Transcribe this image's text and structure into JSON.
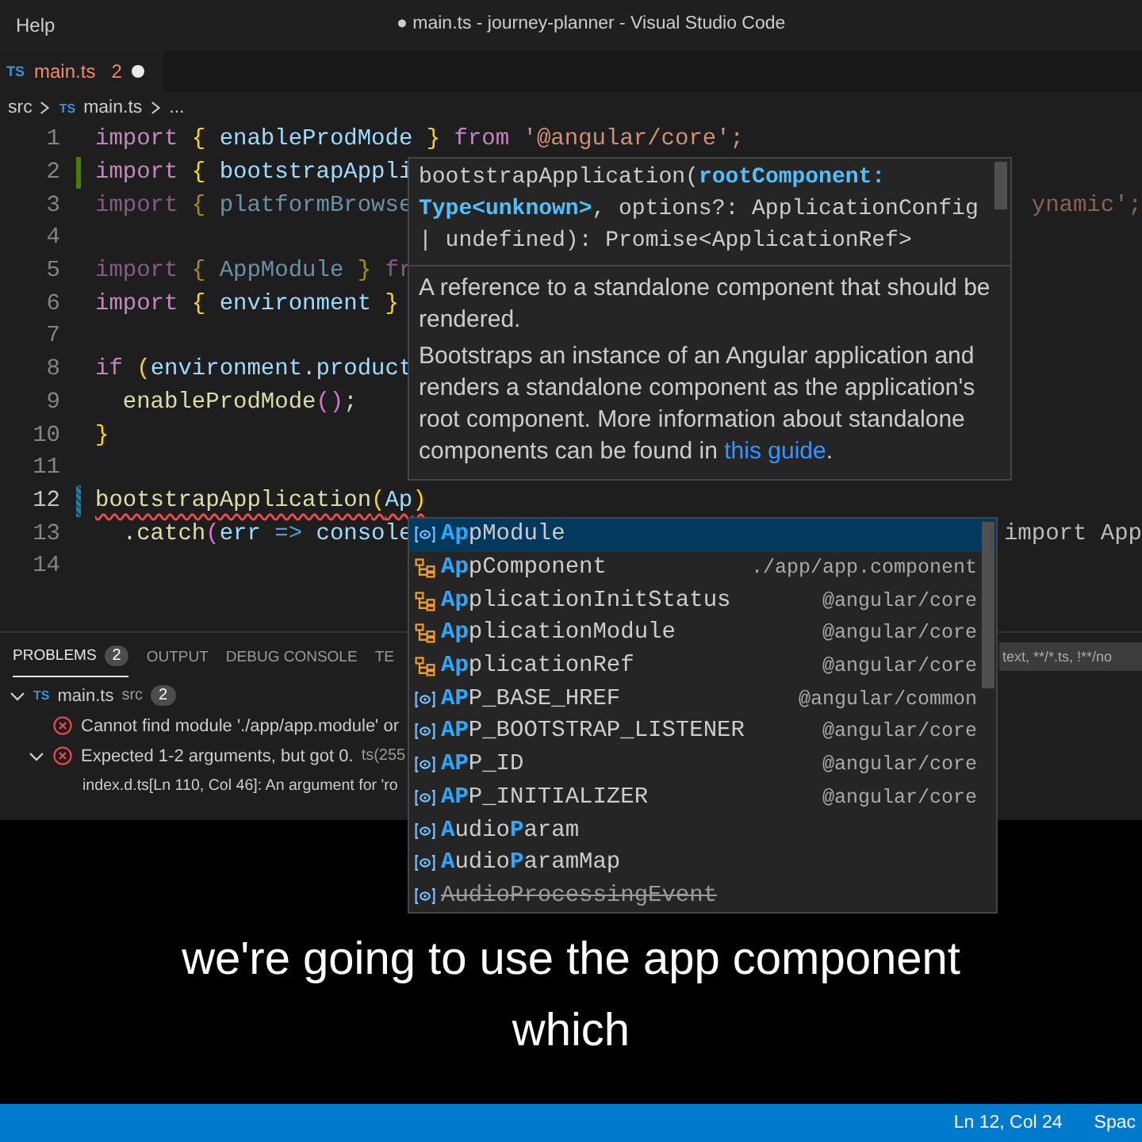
{
  "title_bar": {
    "menu": "Help",
    "title": "● main.ts - journey-planner - Visual Studio Code"
  },
  "editor_tab": {
    "icon_text": "TS",
    "name": "main.ts",
    "problems": "2",
    "dirty": true,
    "selected": true
  },
  "breadcrumb": {
    "folder": "src",
    "icon_text": "TS",
    "file": "main.ts",
    "more": "..."
  },
  "code_lines": [
    {
      "number": "1",
      "added": false,
      "modified": false,
      "current": false,
      "faded": false,
      "error": false,
      "tokens": [
        {
          "t": "import ",
          "kind": "kw"
        },
        {
          "t": "{",
          "kind": "brace"
        },
        {
          "t": " enableProdMode ",
          "kind": "var"
        },
        {
          "t": "}",
          "kind": "brace"
        },
        {
          "t": " from ",
          "kind": "kw"
        },
        {
          "t": "'@angular/core';",
          "kind": "str"
        }
      ]
    },
    {
      "number": "2",
      "added": true,
      "modified": false,
      "current": false,
      "faded": false,
      "error": false,
      "tokens": [
        {
          "t": "import ",
          "kind": "kw"
        },
        {
          "t": "{",
          "kind": "brace"
        },
        {
          "t": " bootstrapAppli",
          "kind": "var"
        }
      ]
    },
    {
      "number": "3",
      "added": false,
      "modified": false,
      "current": false,
      "faded": true,
      "error": false,
      "tokens": [
        {
          "t": "import ",
          "kind": "kw"
        },
        {
          "t": "{",
          "kind": "brace"
        },
        {
          "t": " platformBrowse",
          "kind": "var"
        }
      ],
      "tail": "ynamic';"
    },
    {
      "number": "4",
      "added": false,
      "modified": false,
      "current": false
    },
    {
      "number": "5",
      "added": false,
      "modified": false,
      "current": false,
      "faded": true,
      "error": false,
      "tokens": [
        {
          "t": "import ",
          "kind": "kw"
        },
        {
          "t": "{",
          "kind": "brace"
        },
        {
          "t": " AppModule ",
          "kind": "var"
        },
        {
          "t": "}",
          "kind": "brace"
        },
        {
          "t": " fr",
          "kind": "kw"
        }
      ]
    },
    {
      "number": "6",
      "added": false,
      "modified": false,
      "current": false,
      "faded": false,
      "error": false,
      "tokens": [
        {
          "t": "import ",
          "kind": "kw"
        },
        {
          "t": "{",
          "kind": "brace"
        },
        {
          "t": " environment ",
          "kind": "var"
        },
        {
          "t": "}",
          "kind": "brace"
        }
      ]
    },
    {
      "number": "7",
      "added": false,
      "modified": false,
      "current": false
    },
    {
      "number": "8",
      "added": false,
      "modified": false,
      "current": false,
      "faded": false,
      "error": false,
      "tokens": [
        {
          "t": "if ",
          "kind": "kw"
        },
        {
          "t": "(",
          "kind": "brace"
        },
        {
          "t": "environment.product",
          "kind": "var"
        }
      ]
    },
    {
      "number": "9",
      "added": false,
      "modified": false,
      "current": false,
      "faded": false,
      "error": false,
      "tokens": [
        {
          "t": "  enableProdMode",
          "kind": "fn"
        },
        {
          "t": "()",
          "kind": "paren"
        },
        {
          "t": ";",
          "kind": "plain"
        }
      ]
    },
    {
      "number": "10",
      "added": false,
      "modified": false,
      "current": false,
      "faded": false,
      "error": false,
      "tokens": [
        {
          "t": "}",
          "kind": "brace"
        }
      ]
    },
    {
      "number": "11",
      "added": false,
      "modified": false,
      "current": false
    },
    {
      "number": "12",
      "added": false,
      "modified": true,
      "current": true,
      "faded": false,
      "error": true,
      "tokens": [
        {
          "t": "bootstrapApplication",
          "kind": "fn"
        },
        {
          "t": "(",
          "kind": "brace"
        },
        {
          "t": "Ap",
          "kind": "var"
        },
        {
          "t": ")",
          "kind": "brace"
        }
      ]
    },
    {
      "number": "13",
      "added": false,
      "modified": false,
      "current": false,
      "faded": false,
      "error": false,
      "tokens": [
        {
          "t": "  .catch",
          "kind": "fn"
        },
        {
          "t": "(",
          "kind": "paren"
        },
        {
          "t": "err",
          "kind": "var"
        },
        {
          "t": " => ",
          "kind": "arrow"
        },
        {
          "t": "console",
          "kind": "var"
        }
      ],
      "tail": "import App"
    },
    {
      "number": "14",
      "added": false,
      "modified": false,
      "current": false
    }
  ],
  "hover": {
    "signature": "bootstrapApplication(**rootComponent: Type<unknown>**, options?: ApplicationConfig | undefined): Promise<ApplicationRef>",
    "param_doc": "A reference to a standalone component that should be rendered.",
    "doc": {
      "before": "Bootstraps an instance of an Angular application and renders a standalone component as the application's root component. More information about standalone components can be found in ",
      "link": "this guide",
      "after": "."
    }
  },
  "suggestions": [
    {
      "kind": "variable",
      "selected": true,
      "deprecated": false,
      "label": "**Ap**pModule"
    },
    {
      "kind": "class",
      "selected": false,
      "deprecated": false,
      "label": "**Ap**pComponent",
      "detail": "./app/app.component"
    },
    {
      "kind": "class",
      "selected": false,
      "deprecated": false,
      "label": "**Ap**plicationInitStatus",
      "detail": "@angular/core"
    },
    {
      "kind": "class",
      "selected": false,
      "deprecated": false,
      "label": "**Ap**plicationModule",
      "detail": "@angular/core"
    },
    {
      "kind": "class",
      "selected": false,
      "deprecated": false,
      "label": "**Ap**plicationRef",
      "detail": "@angular/core"
    },
    {
      "kind": "variable",
      "selected": false,
      "deprecated": false,
      "label": "**AP**P_BASE_HREF",
      "detail": "@angular/common"
    },
    {
      "kind": "variable",
      "selected": false,
      "deprecated": false,
      "label": "**AP**P_BOOTSTRAP_LISTENER",
      "detail": "@angular/core"
    },
    {
      "kind": "variable",
      "selected": false,
      "deprecated": false,
      "label": "**AP**P_ID",
      "detail": "@angular/core"
    },
    {
      "kind": "variable",
      "selected": false,
      "deprecated": false,
      "label": "**AP**P_INITIALIZER",
      "detail": "@angular/core"
    },
    {
      "kind": "variable",
      "selected": false,
      "deprecated": false,
      "label": "**A**udio**P**aram"
    },
    {
      "kind": "variable",
      "selected": false,
      "deprecated": false,
      "label": "**A**udio**P**aramMap"
    },
    {
      "kind": "variable",
      "selected": false,
      "deprecated": true,
      "label": "AudioProcessingEvent"
    }
  ],
  "panel": {
    "tabs": [
      {
        "label": "PROBLEMS",
        "badge": "2",
        "selected": true
      },
      {
        "label": "OUTPUT",
        "selected": false
      },
      {
        "label": "DEBUG CONSOLE",
        "selected": false
      },
      {
        "label": "TE",
        "selected": false
      }
    ],
    "filter": {
      "placeholder": "text, **/*.ts, !**/no"
    },
    "file": {
      "icon_text": "TS",
      "name": "main.ts",
      "folder": "src",
      "count": "2",
      "expanded": true
    },
    "problems": [
      {
        "message": "Cannot find module './app/app.module' or"
      },
      {
        "message": "Expected 1-2 arguments, but got 0.",
        "code": "ts(255",
        "expanded": true,
        "related": "index.d.ts[Ln 110, Col 46]: An argument for 'ro"
      }
    ]
  },
  "caption": [
    "we're going to use the app component",
    "which"
  ],
  "status_bar": {
    "position": "Ln 12, Col 24",
    "indent": "Spac"
  }
}
